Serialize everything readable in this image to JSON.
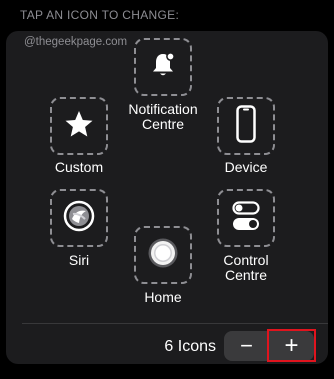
{
  "header": {
    "title": "TAP AN ICON TO CHANGE:"
  },
  "watermark": "@thegeekpage.com",
  "slots": {
    "notification": {
      "label_line1": "Notification",
      "label_line2": "Centre",
      "icon": "bell-icon"
    },
    "custom": {
      "label": "Custom",
      "icon": "star-icon"
    },
    "device": {
      "label": "Device",
      "icon": "iphone-icon"
    },
    "siri": {
      "label": "Siri",
      "icon": "siri-icon"
    },
    "control": {
      "label_line1": "Control",
      "label_line2": "Centre",
      "icon": "toggles-icon"
    },
    "home": {
      "label": "Home",
      "icon": "home-button-icon"
    }
  },
  "footer": {
    "count_label": "6 Icons",
    "minus_symbol": "−",
    "plus_symbol": "+"
  },
  "colors": {
    "background": "#000000",
    "panel": "#1c1c1e",
    "dashed_border": "#8e8e93",
    "stepper": "#3a3a3c",
    "highlight": "#e0141e"
  }
}
